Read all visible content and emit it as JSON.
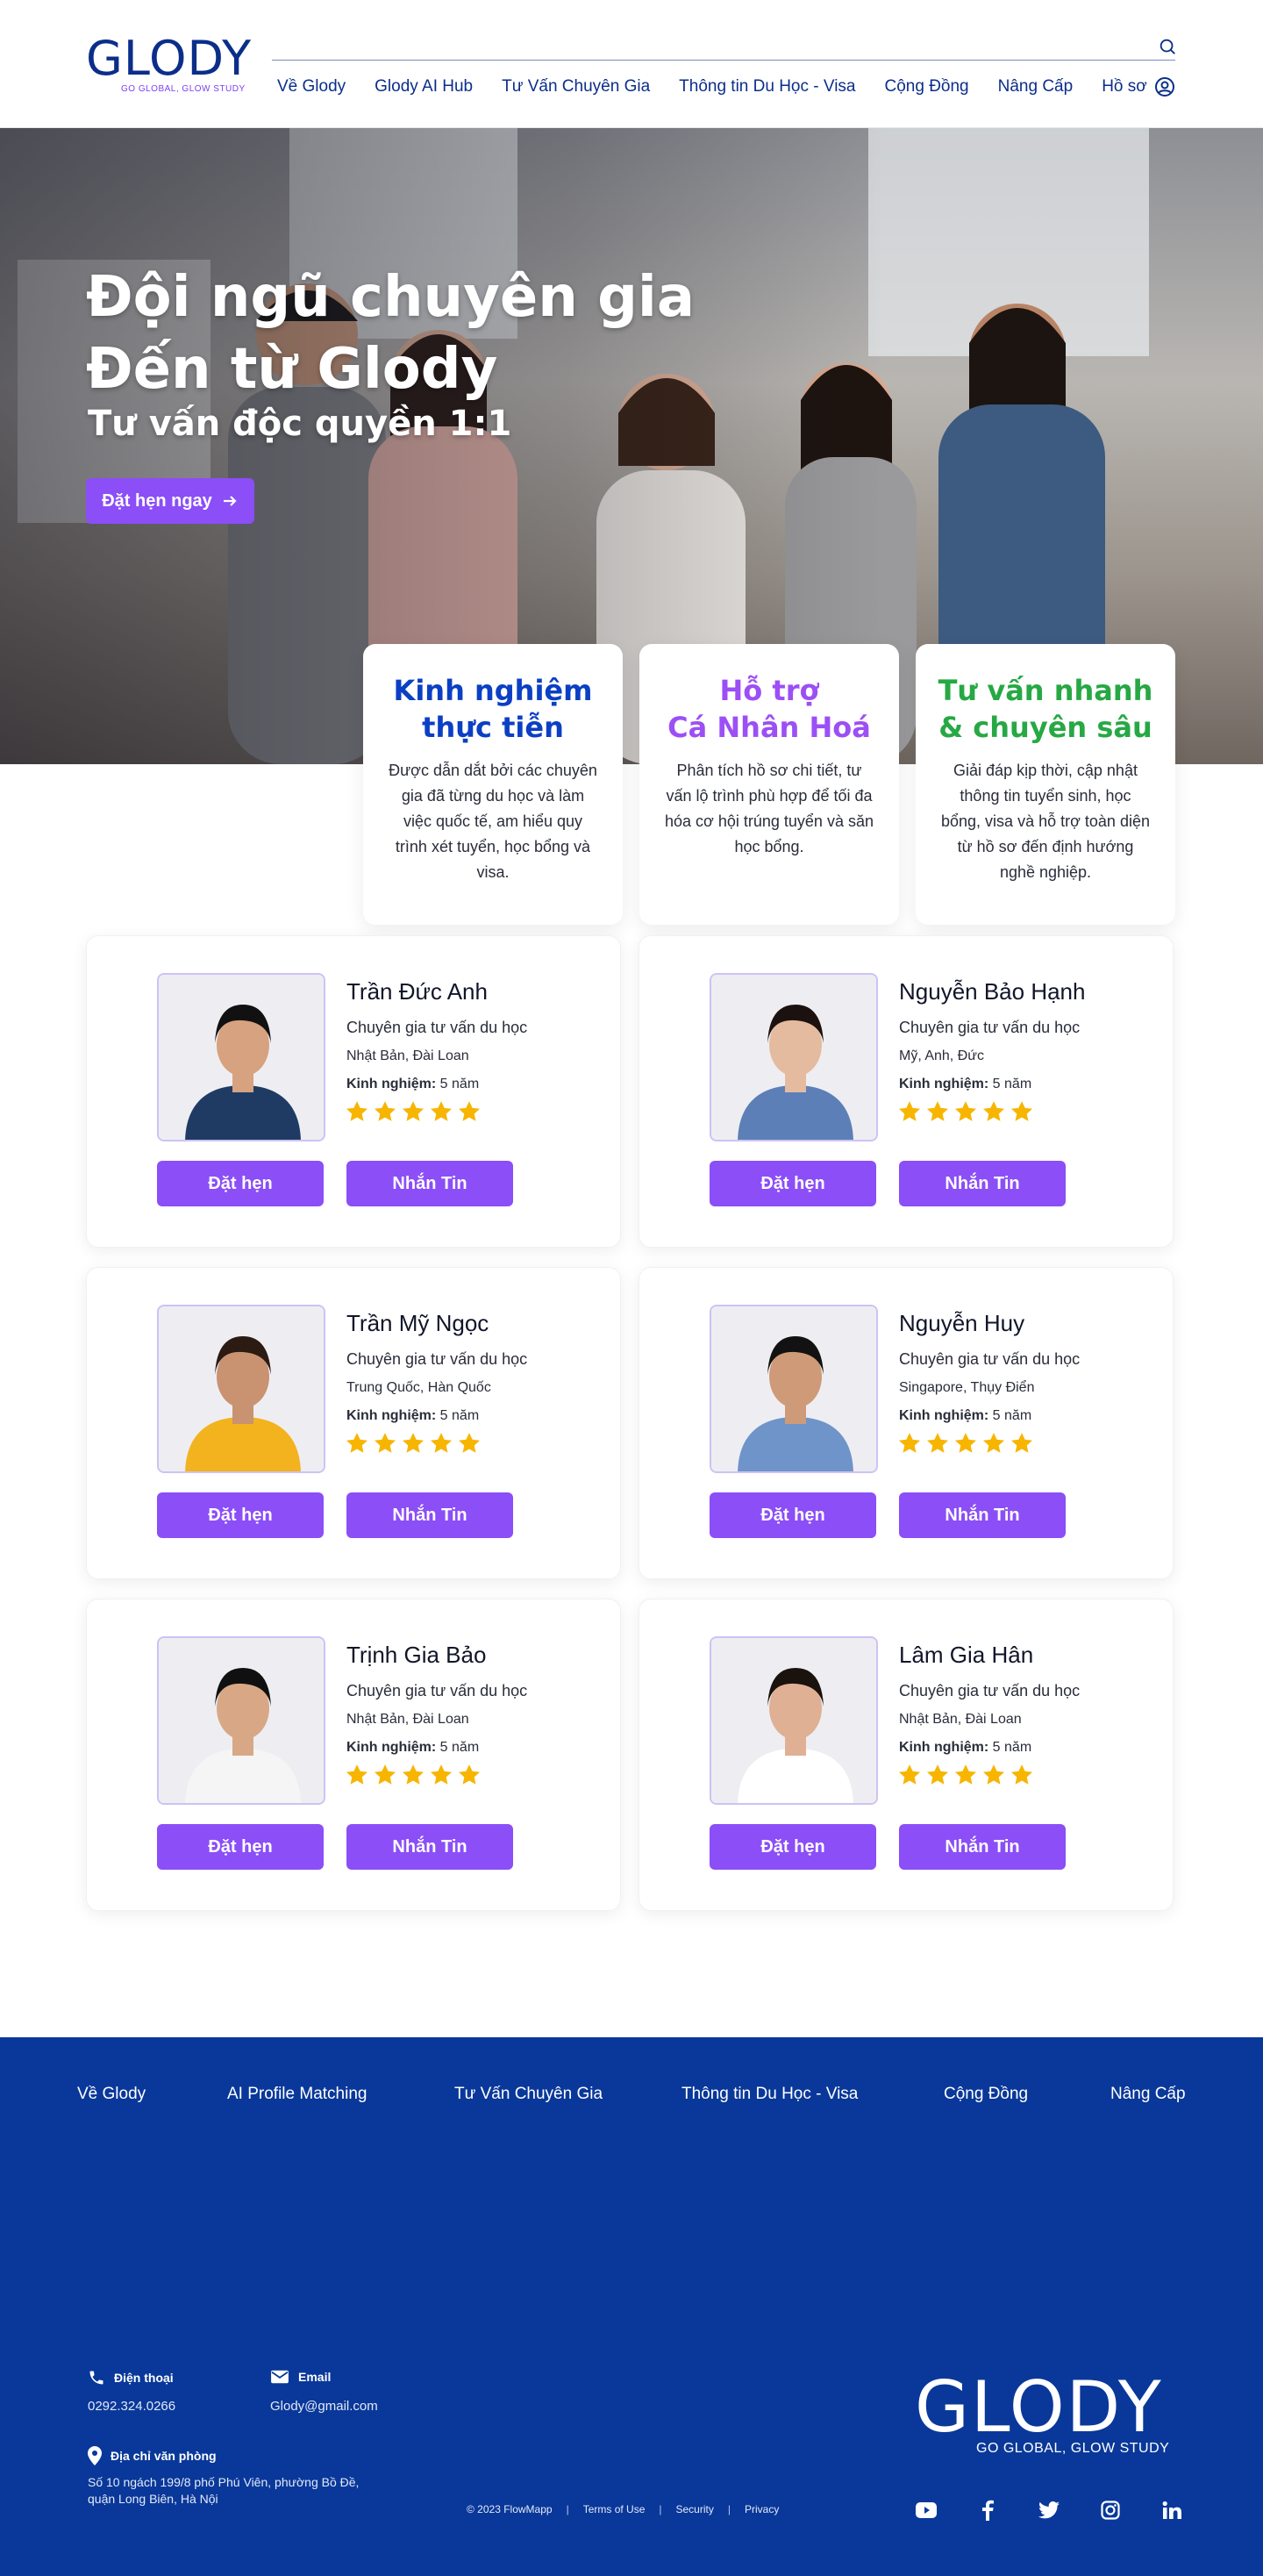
{
  "header": {
    "logo_word": "GLODY",
    "logo_tagline": "GO GLOBAL, GLOW STUDY",
    "nav": [
      "Về Glody",
      "Glody AI Hub",
      "Tư Vấn Chuyên Gia",
      "Thông tin Du Học - Visa",
      "Cộng Đồng",
      "Nâng Cấp",
      "Hồ sơ"
    ]
  },
  "hero": {
    "title_line1": "Đội ngũ chuyên gia",
    "title_line2": "Đến từ Glody",
    "subtitle": "Tư vấn độc quyền 1:1",
    "cta": "Đặt hẹn ngay"
  },
  "features": [
    {
      "title_line1": "Kinh nghiệm",
      "title_line2": "thực tiễn",
      "color": "#0b3fc4",
      "text": "Được dẫn dắt bởi các chuyên gia đã từng du học và làm việc quốc tế, am hiểu quy trình xét tuyển, học bổng và visa."
    },
    {
      "title_line1": "Hỗ trợ",
      "title_line2": "Cá Nhân Hoá",
      "color": "#9b4ff5",
      "text": "Phân tích hồ sơ chi tiết, tư vấn lộ trình phù hợp để tối đa hóa cơ hội trúng tuyển và săn học bổng."
    },
    {
      "title_line1": "Tư vấn nhanh",
      "title_line2": "& chuyên sâu",
      "color": "#27a844",
      "text": "Giải đáp kịp thời, cập nhật thông tin tuyển sinh, học bổng, visa và hỗ trợ toàn diện từ hồ sơ đến định hướng nghề nghiệp."
    }
  ],
  "experts": [
    {
      "name": "Trần Đức Anh",
      "role": "Chuyên gia tư vấn du học",
      "countries": "Nhật Bản, Đài Loan",
      "exp_label": "Kinh nghiệm:",
      "exp_value": "5 năm",
      "rating": 5
    },
    {
      "name": "Nguyễn Bảo Hạnh",
      "role": "Chuyên gia tư vấn du học",
      "countries": "Mỹ, Anh, Đức",
      "exp_label": "Kinh nghiệm:",
      "exp_value": "5 năm",
      "rating": 5
    },
    {
      "name": "Trần Mỹ Ngọc",
      "role": "Chuyên gia tư vấn du học",
      "countries": "Trung Quốc, Hàn Quốc",
      "exp_label": "Kinh nghiệm:",
      "exp_value": "5 năm",
      "rating": 5
    },
    {
      "name": "Nguyễn Huy",
      "role": "Chuyên gia tư vấn du học",
      "countries": "Singapore, Thụy Điển",
      "exp_label": "Kinh nghiệm:",
      "exp_value": "5 năm",
      "rating": 5
    },
    {
      "name": "Trịnh Gia Bảo",
      "role": "Chuyên gia tư vấn du học",
      "countries": "Nhật Bản, Đài Loan",
      "exp_label": "Kinh nghiệm:",
      "exp_value": "5 năm",
      "rating": 5
    },
    {
      "name": "Lâm Gia Hân",
      "role": "Chuyên gia tư vấn du học",
      "countries": "Nhật Bản, Đài Loan",
      "exp_label": "Kinh nghiệm:",
      "exp_value": "5 năm",
      "rating": 5
    }
  ],
  "buttons": {
    "book": "Đặt hẹn",
    "message": "Nhắn Tin"
  },
  "footer": {
    "nav": [
      "Về Glody",
      "AI Profile Matching",
      "Tư Vấn Chuyên Gia",
      "Thông tin Du Học - Visa",
      "Cộng Đồng",
      "Nâng Cấp"
    ],
    "phone_label": "Điện thoại",
    "phone": "0292.324.0266",
    "email_label": "Email",
    "email": "Glody@gmail.com",
    "address_label": "Địa chỉ văn phòng",
    "address": "Số 10 ngách 199/8 phố Phú Viên, phường Bồ Đề, quận Long Biên, Hà Nội",
    "copyright": "© 2023 FlowMapp",
    "links": [
      "Terms of Use",
      "Security",
      "Privacy"
    ],
    "logo_word": "GLODY",
    "logo_tagline": "GO GLOBAL, GLOW STUDY",
    "social": [
      "youtube-icon",
      "facebook-icon",
      "twitter-icon",
      "instagram-icon",
      "linkedin-icon"
    ]
  },
  "colors": {
    "brand": "#0b2e8a",
    "accent": "#8b4ef7",
    "footer_bg": "#09389a",
    "star": "#f7b500"
  }
}
